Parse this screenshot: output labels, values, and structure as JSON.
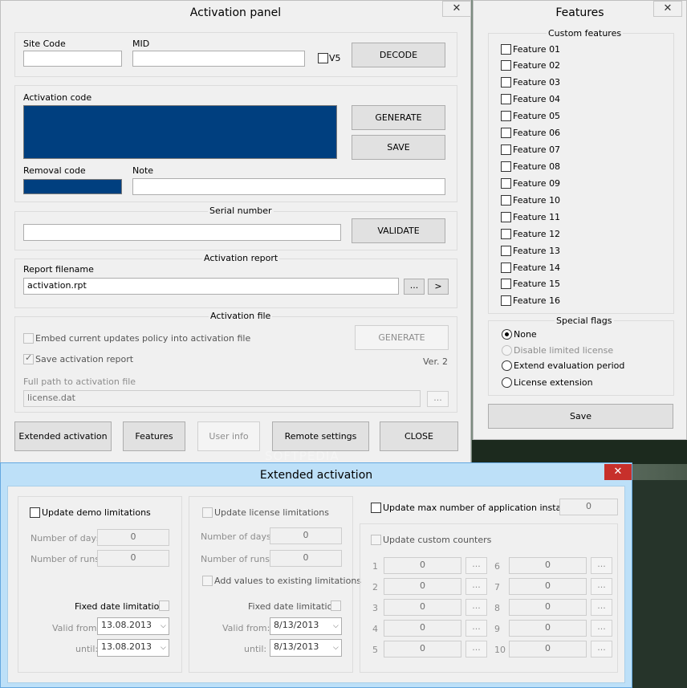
{
  "activation": {
    "title": "Activation panel",
    "close_glyph": "✕",
    "site_code_label": "Site Code",
    "mid_label": "MID",
    "v5_label": "V5",
    "decode": "DECODE",
    "activation_code_label": "Activation code",
    "generate": "GENERATE",
    "save": "SAVE",
    "removal_code_label": "Removal code",
    "note_label": "Note",
    "serial_group": "Serial number",
    "validate": "VALIDATE",
    "report_group": "Activation report",
    "report_filename_label": "Report filename",
    "report_filename": "activation.rpt",
    "browse": "...",
    "go": ">",
    "file_group": "Activation file",
    "embed_label": "Embed current updates policy into activation file",
    "file_generate": "GENERATE",
    "save_report_label": "Save activation report",
    "version": "Ver. 2",
    "full_path_label": "Full path to activation file",
    "full_path": "license.dat",
    "path_browse": "...",
    "buttons": {
      "extended": "Extended activation",
      "features": "Features",
      "user_info": "User info",
      "remote": "Remote settings",
      "close": "CLOSE"
    }
  },
  "features": {
    "title": "Features",
    "close_glyph": "✕",
    "custom_group": "Custom features",
    "items": [
      "Feature 01",
      "Feature 02",
      "Feature 03",
      "Feature 04",
      "Feature 05",
      "Feature 06",
      "Feature 07",
      "Feature 08",
      "Feature 09",
      "Feature 10",
      "Feature 11",
      "Feature 12",
      "Feature 13",
      "Feature 14",
      "Feature 15",
      "Feature 16"
    ],
    "flags_group": "Special flags",
    "flags": [
      "None",
      "Disable limited license",
      "Extend evaluation period",
      "License extension"
    ],
    "save": "Save"
  },
  "extended": {
    "title": "Extended activation",
    "close_glyph": "✕",
    "demo": {
      "label": "Update demo limitations",
      "days_label": "Number of days",
      "days": "0",
      "runs_label": "Number of runs",
      "runs": "0",
      "fixed_label": "Fixed date limitation",
      "from_label": "Valid from:",
      "from": "13.08.2013",
      "until_label": "until:",
      "until": "13.08.2013"
    },
    "license": {
      "label": "Update license limitations",
      "days_label": "Number of days",
      "days": "0",
      "runs_label": "Number of runs",
      "runs": "0",
      "add_label": "Add values to existing limitations",
      "fixed_label": "Fixed date limitation",
      "from_label": "Valid from:",
      "from": "8/13/2013",
      "until_label": "until:",
      "until": "8/13/2013"
    },
    "max_instances_label": "Update max number of application instances",
    "max_instances": "0",
    "custom_counters_label": "Update custom counters",
    "counters": [
      {
        "n": "1",
        "v": "0"
      },
      {
        "n": "2",
        "v": "0"
      },
      {
        "n": "3",
        "v": "0"
      },
      {
        "n": "4",
        "v": "0"
      },
      {
        "n": "5",
        "v": "0"
      },
      {
        "n": "6",
        "v": "0"
      },
      {
        "n": "7",
        "v": "0"
      },
      {
        "n": "8",
        "v": "0"
      },
      {
        "n": "9",
        "v": "0"
      },
      {
        "n": "10",
        "v": "0"
      }
    ],
    "counter_browse": "..."
  },
  "watermark": "SOFTPEDIA"
}
